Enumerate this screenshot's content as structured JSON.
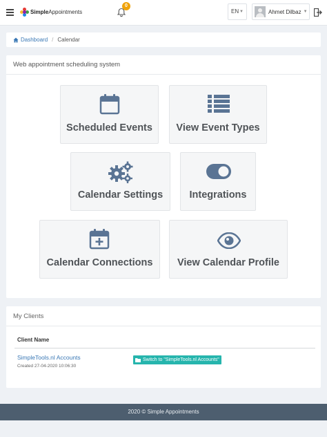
{
  "header": {
    "logo": {
      "brand": "Simple",
      "suffix": "Appointments"
    },
    "notification_count": "0",
    "language": "EN",
    "user_name": "Ahmet Dilbaz"
  },
  "breadcrumb": {
    "home": "Dashboard",
    "current": "Calendar"
  },
  "main_panel": {
    "title": "Web appointment scheduling system",
    "tiles": [
      {
        "label": "Scheduled Events",
        "icon": "calendar-icon"
      },
      {
        "label": "View Event Types",
        "icon": "list-icon"
      },
      {
        "label": "Calendar Settings",
        "icon": "gears-icon"
      },
      {
        "label": "Integrations",
        "icon": "toggle-icon"
      },
      {
        "label": "Calendar Connections",
        "icon": "calendar-plus-icon"
      },
      {
        "label": "View Calendar Profile",
        "icon": "eye-icon"
      }
    ]
  },
  "clients": {
    "title": "My Clients",
    "column_header": "Client Name",
    "rows": [
      {
        "name": "SimpleTools.nl Accounts",
        "created": "Created 27-04-2020 10:06:30",
        "switch_label": "Switch to \"SimpleTools.nl Accounts\""
      }
    ]
  },
  "footer": {
    "text": "2020 © Simple Appointments"
  },
  "colors": {
    "accent_link": "#3a78b5",
    "icon": "#5a7494",
    "switch_button": "#26b5ad",
    "footer_bg": "#4d5e6f",
    "badge": "#f0a30a"
  }
}
